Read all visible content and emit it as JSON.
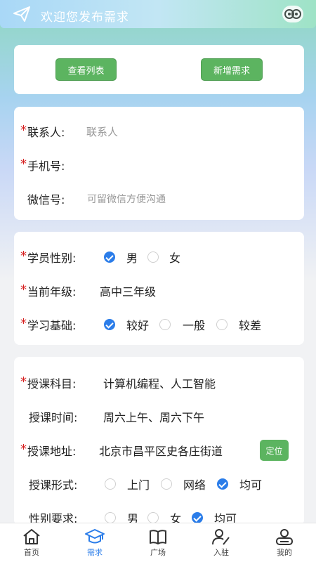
{
  "header": {
    "title": "欢迎您发布需求"
  },
  "actions": {
    "view_list": "查看列表",
    "add_demand": "新增需求"
  },
  "contact": {
    "name_label": "联系人:",
    "name_placeholder": "联系人",
    "phone_label": "手机号:",
    "wechat_label": "微信号:",
    "wechat_placeholder": "可留微信方便沟通"
  },
  "student": {
    "gender_label": "学员性别:",
    "gender_options": [
      "男",
      "女"
    ],
    "gender_selected": "男",
    "grade_label": "当前年级:",
    "grade_value": "高中三年级",
    "basis_label": "学习基础:",
    "basis_options": [
      "较好",
      "一般",
      "较差"
    ],
    "basis_selected": "较好"
  },
  "course": {
    "subject_label": "授课科目:",
    "subject_value": "计算机编程、人工智能",
    "time_label": "授课时间:",
    "time_value": "周六上午、周六下午",
    "address_label": "授课地址:",
    "address_value": "北京市昌平区史各庄街道",
    "locate_button": "定位",
    "form_label": "授课形式:",
    "form_options": [
      "上门",
      "网络",
      "均可"
    ],
    "form_selected": "均可",
    "teacher_gender_label": "性别要求:",
    "teacher_gender_options": [
      "男",
      "女",
      "均可"
    ],
    "teacher_gender_selected": "均可"
  },
  "tabbar": {
    "items": [
      {
        "label": "首页",
        "icon": "home-icon"
      },
      {
        "label": "需求",
        "icon": "graduation-cap-icon"
      },
      {
        "label": "广场",
        "icon": "book-icon"
      },
      {
        "label": "入驻",
        "icon": "user-edit-icon"
      },
      {
        "label": "我的",
        "icon": "profile-icon"
      }
    ],
    "active": "需求"
  },
  "colors": {
    "accent": "#2b7de9",
    "button_green": "#5cb460",
    "required_star": "#d62020"
  }
}
